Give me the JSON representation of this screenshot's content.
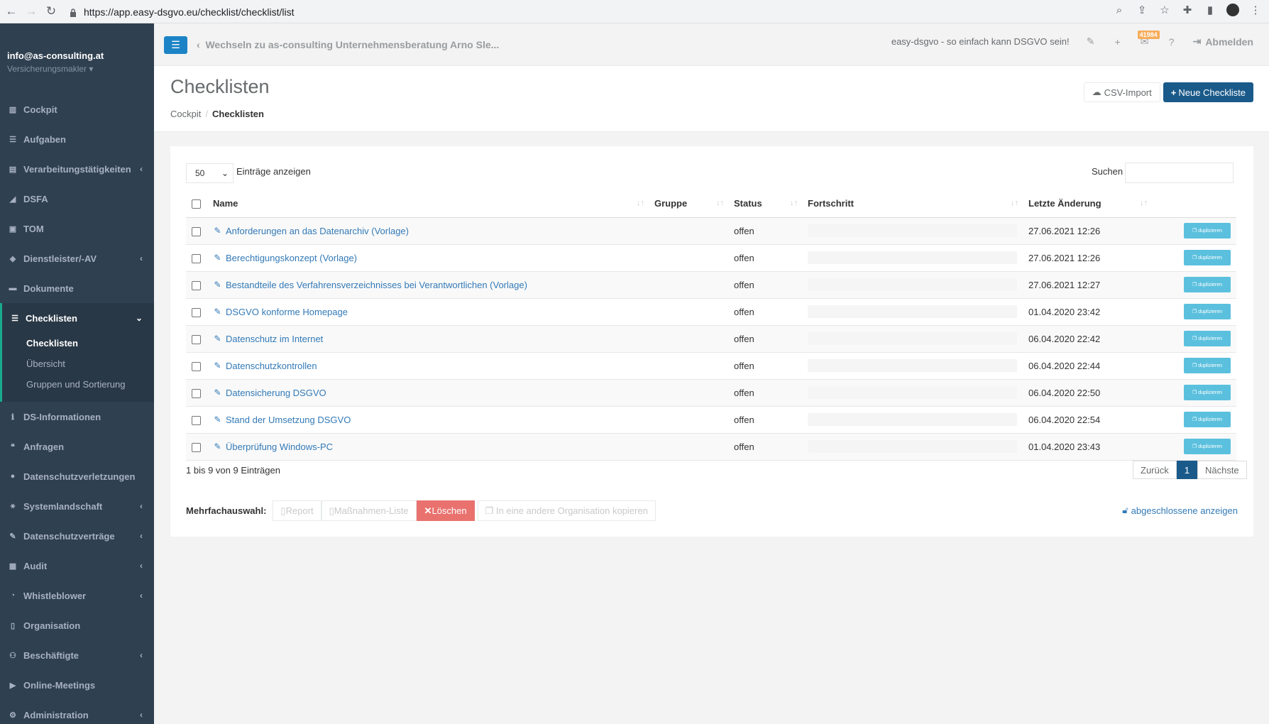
{
  "browser": {
    "url": "https://app.easy-dsgvo.eu/checklist/checklist/list"
  },
  "sidebar": {
    "user_email": "info@as-consulting.at",
    "user_role": "Versicherungsmakler",
    "items": [
      {
        "label": "Cockpit"
      },
      {
        "label": "Aufgaben"
      },
      {
        "label": "Verarbeitungstätigkeiten"
      },
      {
        "label": "DSFA"
      },
      {
        "label": "TOM"
      },
      {
        "label": "Dienstleister/-AV"
      },
      {
        "label": "Dokumente"
      },
      {
        "label": "Checklisten"
      },
      {
        "label": "DS-Informationen"
      },
      {
        "label": "Anfragen"
      },
      {
        "label": "Datenschutzverletzungen"
      },
      {
        "label": "Systemlandschaft"
      },
      {
        "label": "Datenschutzverträge"
      },
      {
        "label": "Audit"
      },
      {
        "label": "Whistleblower"
      },
      {
        "label": "Organisation"
      },
      {
        "label": "Beschäftigte"
      },
      {
        "label": "Online-Meetings"
      },
      {
        "label": "Administration"
      }
    ],
    "subitems": [
      {
        "label": "Checklisten"
      },
      {
        "label": "Übersicht"
      },
      {
        "label": "Gruppen und Sortierung"
      }
    ]
  },
  "topnav": {
    "switch_org": "Wechseln zu as-consulting Unternehmensberatung Arno Sle...",
    "slogan": "easy-dsgvo - so einfach kann DSGVO sein!",
    "mail_count": "41984",
    "logout": "Abmelden"
  },
  "heading": {
    "title": "Checklisten",
    "breadcrumb_home": "Cockpit",
    "breadcrumb_current": "Checklisten",
    "csv_import": "CSV-Import",
    "new_checklist": "Neue Checkliste"
  },
  "table": {
    "page_length": "50",
    "length_label": "Einträge anzeigen",
    "search_label": "Suchen",
    "columns": [
      "Name",
      "Gruppe",
      "Status",
      "Fortschritt",
      "Letzte Änderung"
    ],
    "duplicate_label": "duplizieren",
    "rows": [
      {
        "name": "Anforderungen an das Datenarchiv (Vorlage)",
        "group": "",
        "status": "offen",
        "date": "27.06.2021 12:26"
      },
      {
        "name": "Berechtigungskonzept (Vorlage)",
        "group": "",
        "status": "offen",
        "date": "27.06.2021 12:26"
      },
      {
        "name": "Bestandteile des Verfahrensverzeichnisses bei Verantwortlichen (Vorlage)",
        "group": "",
        "status": "offen",
        "date": "27.06.2021 12:27"
      },
      {
        "name": "DSGVO konforme Homepage",
        "group": "",
        "status": "offen",
        "date": "01.04.2020 23:42"
      },
      {
        "name": "Datenschutz im Internet",
        "group": "",
        "status": "offen",
        "date": "06.04.2020 22:42"
      },
      {
        "name": "Datenschutzkontrollen",
        "group": "",
        "status": "offen",
        "date": "06.04.2020 22:44"
      },
      {
        "name": "Datensicherung DSGVO",
        "group": "",
        "status": "offen",
        "date": "06.04.2020 22:50"
      },
      {
        "name": "Stand der Umsetzung DSGVO",
        "group": "",
        "status": "offen",
        "date": "06.04.2020 22:54"
      },
      {
        "name": "Überprüfung Windows-PC",
        "group": "",
        "status": "offen",
        "date": "01.04.2020 23:43"
      }
    ],
    "info": "1 bis 9 von 9 Einträgen",
    "prev": "Zurück",
    "page": "1",
    "next": "Nächste"
  },
  "multi": {
    "label": "Mehrfachauswahl:",
    "report": "Report",
    "measures": "Maßnahmen-Liste",
    "delete": "Löschen",
    "copy": "In eine andere Organisation kopieren",
    "show_closed": "abgeschlossene anzeigen"
  }
}
